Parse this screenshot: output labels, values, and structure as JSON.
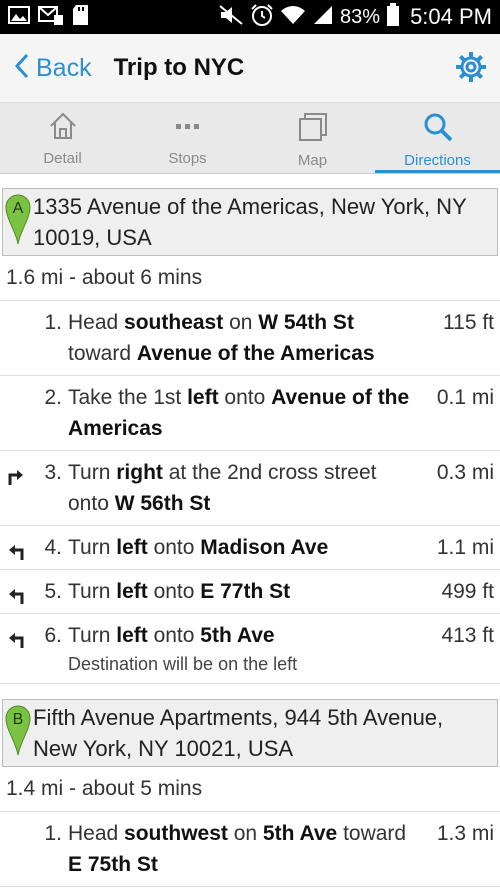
{
  "statusbar": {
    "battery": "83%",
    "time": "5:04 PM"
  },
  "appbar": {
    "back_label": "Back",
    "title": "Trip to NYC"
  },
  "tabs": [
    {
      "label": "Detail"
    },
    {
      "label": "Stops"
    },
    {
      "label": "Map"
    },
    {
      "label": "Directions"
    }
  ],
  "legs": [
    {
      "marker": "A",
      "address": "1335 Avenue of the Americas, New York, NY 10019, USA",
      "summary": "1.6 mi - about 6 mins",
      "steps": [
        {
          "num": "1.",
          "p1": "Head ",
          "b1": "southeast",
          "p2": " on ",
          "b2": "W 54th St",
          "p3": " toward ",
          "b3": "Avenue of the Americas",
          "dist": "115 ft"
        },
        {
          "num": "2.",
          "p1": "Take the 1st ",
          "b1": "left",
          "p2": " onto ",
          "b2": "Avenue of the Americas",
          "dist": "0.1 mi"
        },
        {
          "num": "3.",
          "p1": "Turn ",
          "b1": "right",
          "p2": " at the 2nd cross street onto ",
          "b2": "W 56th St",
          "dist": "0.3 mi",
          "turn": "right"
        },
        {
          "num": "4.",
          "p1": "Turn ",
          "b1": "left",
          "p2": " onto ",
          "b2": "Madison Ave",
          "dist": "1.1 mi",
          "turn": "left"
        },
        {
          "num": "5.",
          "p1": "Turn ",
          "b1": "left",
          "p2": " onto ",
          "b2": "E 77th St",
          "dist": "499 ft",
          "turn": "left"
        },
        {
          "num": "6.",
          "p1": "Turn ",
          "b1": "left",
          "p2": " onto ",
          "b2": "5th Ave",
          "dist": "413 ft",
          "turn": "left",
          "note": "Destination will be on the left"
        }
      ]
    },
    {
      "marker": "B",
      "address": "Fifth Avenue Apartments, 944 5th Avenue, New York, NY 10021, USA",
      "summary": "1.4 mi - about 5 mins",
      "steps": [
        {
          "num": "1.",
          "p1": "Head ",
          "b1": "southwest",
          "p2": " on ",
          "b2": "5th Ave",
          "p3": " toward ",
          "b3": "E 75th St",
          "dist": "1.3 mi"
        }
      ]
    }
  ],
  "colors": {
    "accent": "#2b8fd3",
    "pin": "#7cc242"
  }
}
